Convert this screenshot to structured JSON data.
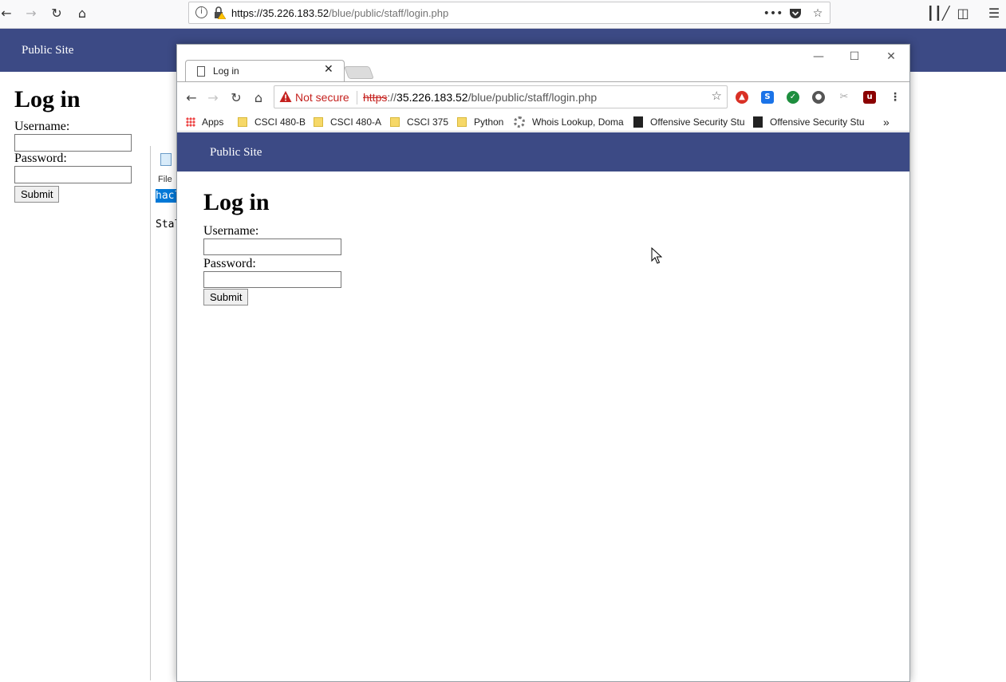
{
  "firefox": {
    "url_host": "https://35.226.183.52",
    "url_path": "/blue/public/staff/login.php",
    "icons": [
      "back-icon",
      "forward-icon",
      "reload-icon",
      "home-icon",
      "info-icon",
      "insecure-lock-icon",
      "more-icon",
      "pocket-icon",
      "bookmark-star-icon",
      "library-icon",
      "sidebar-icon",
      "menu-icon"
    ]
  },
  "back_page": {
    "header_link": "Public Site",
    "title": "Log in",
    "username_label": "Username:",
    "password_label": "Password:",
    "submit_label": "Submit"
  },
  "notepad": {
    "menu_file": "File",
    "selected_text": "hacl",
    "line_text": "Stal"
  },
  "chrome": {
    "tab_title": "Log in",
    "security_label": "Not secure",
    "url_scheme": "https",
    "url_sep": "://",
    "url_host": "35.226.183.52",
    "url_path": "/blue/public/staff/login.php",
    "bookmarks": [
      "Apps",
      "CSCI 480-B",
      "CSCI 480-A",
      "CSCI 375",
      "Python",
      "Whois Lookup, Doma",
      "Offensive Security Stu",
      "Offensive Security Stu"
    ],
    "overflow": "»"
  },
  "front_page": {
    "header_link": "Public Site",
    "title": "Log in",
    "username_label": "Username:",
    "password_label": "Password:",
    "submit_label": "Submit"
  }
}
